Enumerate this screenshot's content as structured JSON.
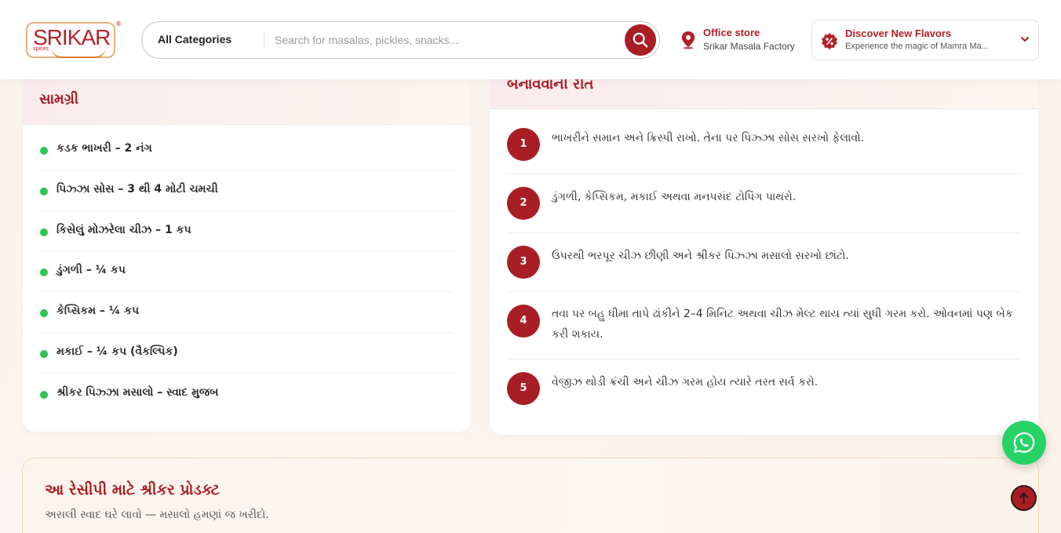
{
  "header": {
    "logo": {
      "text": "SRIKAR",
      "subtext": "spices",
      "reg": "®"
    },
    "search": {
      "category": "All Categories",
      "placeholder": "Search for masalas, pickles, snacks..."
    },
    "store": {
      "title": "Office store",
      "subtitle": "Srikar Masala Factory"
    },
    "discover": {
      "title": "Discover New Flavors",
      "subtitle": "Experience the magic of Mamra Ma..."
    }
  },
  "ingredients": {
    "title": "સામગ્રી",
    "items": [
      "કડક ભાખરી – 2 નંગ",
      "પિઝ્ઝા સોસ – 3 થી 4 મોટી ચમચી",
      "કિસેલું મોઝરેલા ચીઝ – 1 કપ",
      "ડુંગળી – ¼ કપ",
      "કેપ્સિકમ – ¼ કપ",
      "મકાઈ – ¼ કપ (વૈકલ્પિક)",
      "શ્રીકર પિઝ્ઝા મસાલો – સ્વાદ મુજબ"
    ]
  },
  "method": {
    "title": "બનાવવાની રીત",
    "steps": [
      {
        "num": "1",
        "text": "ભાખરીને સમાન અને ક્રિસ્પી રાખો. તેના પર પિઝ્ઝા સોસ સરખો ફેલાવો."
      },
      {
        "num": "2",
        "text": "ડુંગળી, કેપ્સિકમ, મકાઈ અથવા મનપસંદ ટોપિંગ પાથરો."
      },
      {
        "num": "3",
        "text": "ઉપરથી ભરપૂર ચીઝ છીણી અને શ્રીકર પિઝ્ઝા મસાલો સરખો છાંટો."
      },
      {
        "num": "4",
        "text": "તવા પર બહુ ધીમા તાપે ઢાંકીને 2–4 મિનિટ અથવા ચીઝ મેલ્ટ થાય ત્યાં સુધી ગરમ કરો. ઓવનમાં પણ બેક કરી શકાય."
      },
      {
        "num": "5",
        "text": "વેજીઝ થોડી ક્રંચી અને ચીઝ ગરમ હોય ત્યારે તરત સર્વ કરો."
      }
    ]
  },
  "products": {
    "title": "આ રેસીપી માટે શ્રીકર પ્રોડક્ટ",
    "subtitle": "અસલી સ્વાદ ઘરે લાવો — મસાલો હમણાં જ ખરીદો."
  },
  "colors": {
    "brand": "#a91d25",
    "bullet": "#2bc552",
    "whatsapp": "#25d366"
  },
  "icons": [
    "search-icon",
    "location-pin-icon",
    "discount-badge-icon",
    "chevron-down-icon",
    "whatsapp-icon",
    "arrow-up-icon"
  ]
}
